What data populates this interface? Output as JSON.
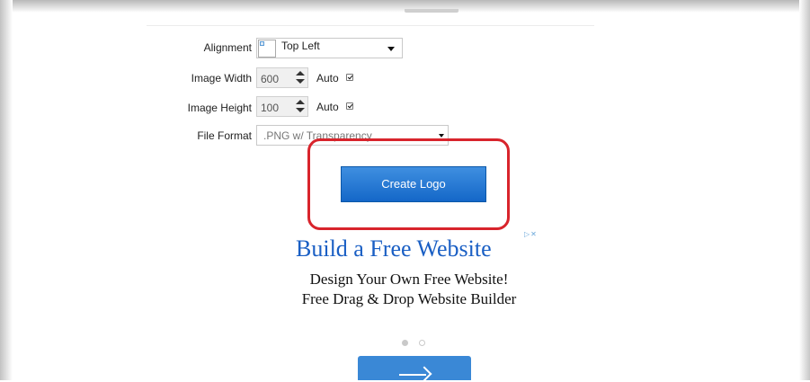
{
  "form": {
    "alignment": {
      "label": "Alignment",
      "value": "Top Left"
    },
    "image_width": {
      "label": "Image Width",
      "value": "600",
      "auto_label": "Auto",
      "auto_checked": true
    },
    "image_height": {
      "label": "Image Height",
      "value": "100",
      "auto_label": "Auto",
      "auto_checked": true
    },
    "file_format": {
      "label": "File Format",
      "value": ".PNG w/ Transparency"
    },
    "create_button": "Create Logo"
  },
  "ad": {
    "title": "Build a Free Website",
    "body": "Design Your Own Free Website! Free Drag & Drop Website Builder",
    "choices_glyph": "▷✕",
    "slides": 2,
    "active_slide": 1,
    "cta_icon": "arrow-right-icon"
  },
  "colors": {
    "button_top": "#3f8fe0",
    "button_bottom": "#1467c8",
    "highlight": "#d8242c",
    "ad_title": "#1a5fc4",
    "cta": "#3a88d6"
  }
}
